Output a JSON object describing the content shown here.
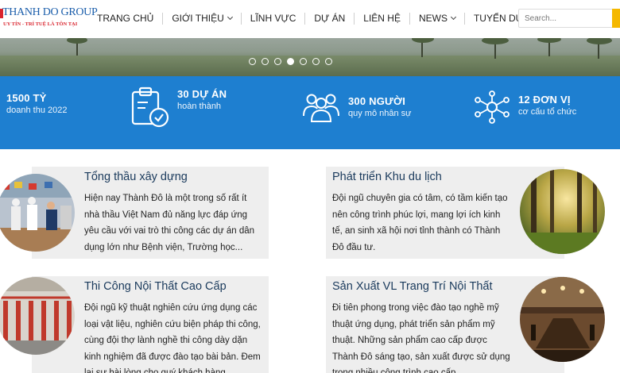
{
  "header": {
    "logo_name": "THANH DO GROUP",
    "logo_tagline": "UY TÍN - TRÍ TUỆ LÀ TÔN TẠI",
    "nav": [
      {
        "label": "TRANG CHỦ",
        "dropdown": false
      },
      {
        "label": "GIỚI THIỆU",
        "dropdown": true
      },
      {
        "label": "LĨNH VỰC",
        "dropdown": false
      },
      {
        "label": "DỰ ÁN",
        "dropdown": false
      },
      {
        "label": "LIÊN HỆ",
        "dropdown": false
      },
      {
        "label": "NEWS",
        "dropdown": true
      },
      {
        "label": "TUYỂN DỤNG",
        "dropdown": false
      }
    ],
    "search_placeholder": "Search..."
  },
  "slider": {
    "slide_count": 7,
    "active_index": 3
  },
  "stats": [
    {
      "number": "1500 TỶ",
      "label": "doanh thu 2022",
      "icon": "none"
    },
    {
      "number": "30 DỰ ÁN",
      "label": "hoàn thành",
      "icon": "clipboard-check-icon"
    },
    {
      "number": "300 NGƯỜI",
      "label": "quy mô nhân sự",
      "icon": "people-group-icon"
    },
    {
      "number": "12 ĐƠN VỊ",
      "label": "cơ cấu tổ chức",
      "icon": "network-icon"
    }
  ],
  "cards": [
    {
      "title": "Tổng thầu xây dựng",
      "text": "Hiện nay Thành Đô là một trong số rất ít nhà thầu Việt Nam đủ năng lực đáp ứng yêu cầu với vai trò thi công các dự án dân dụng lớn như Bệnh viện, Trường học...",
      "image": "construction-ceremony-photo"
    },
    {
      "title": "Phát triển Khu du lịch",
      "text": "Đội ngũ chuyên gia có tâm, có tầm kiến tạo nên công trình phúc lợi, mang lợi ích kinh tế, an sinh xã hội nơi tỉnh thành có Thành Đô đầu tư.",
      "image": "forest-photo"
    },
    {
      "title": "Thi Công Nội Thất Cao Cấp",
      "text": "Đội ngũ kỹ thuật nghiên cứu ứng dụng các loại vật liệu, nghiên cứu biện pháp thi công, cùng đội thợ lành nghề thi công dày dặn kinh nghiệm đã được đào tạo bài bản. Đem lại sự hài lòng cho quý khách hàng.",
      "image": "interior-hall-photo"
    },
    {
      "title": "Sản Xuất VL Trang Trí Nội Thất",
      "text": "Đi tiên phong trong việc đào tạo nghề mỹ thuật ứng dụng, phát triển sản phẩm mỹ thuật. Những sản phẩm cao cấp được Thành Đô sáng tạo, sản xuất được sử dụng trong nhiều công trình cao cấp.",
      "image": "conference-room-photo"
    }
  ],
  "colors": {
    "brand_blue": "#1e7fd0",
    "logo_blue": "#1b5eab",
    "logo_red": "#d9232d",
    "search_accent": "#f5b800",
    "card_bg": "#eeeeee"
  }
}
